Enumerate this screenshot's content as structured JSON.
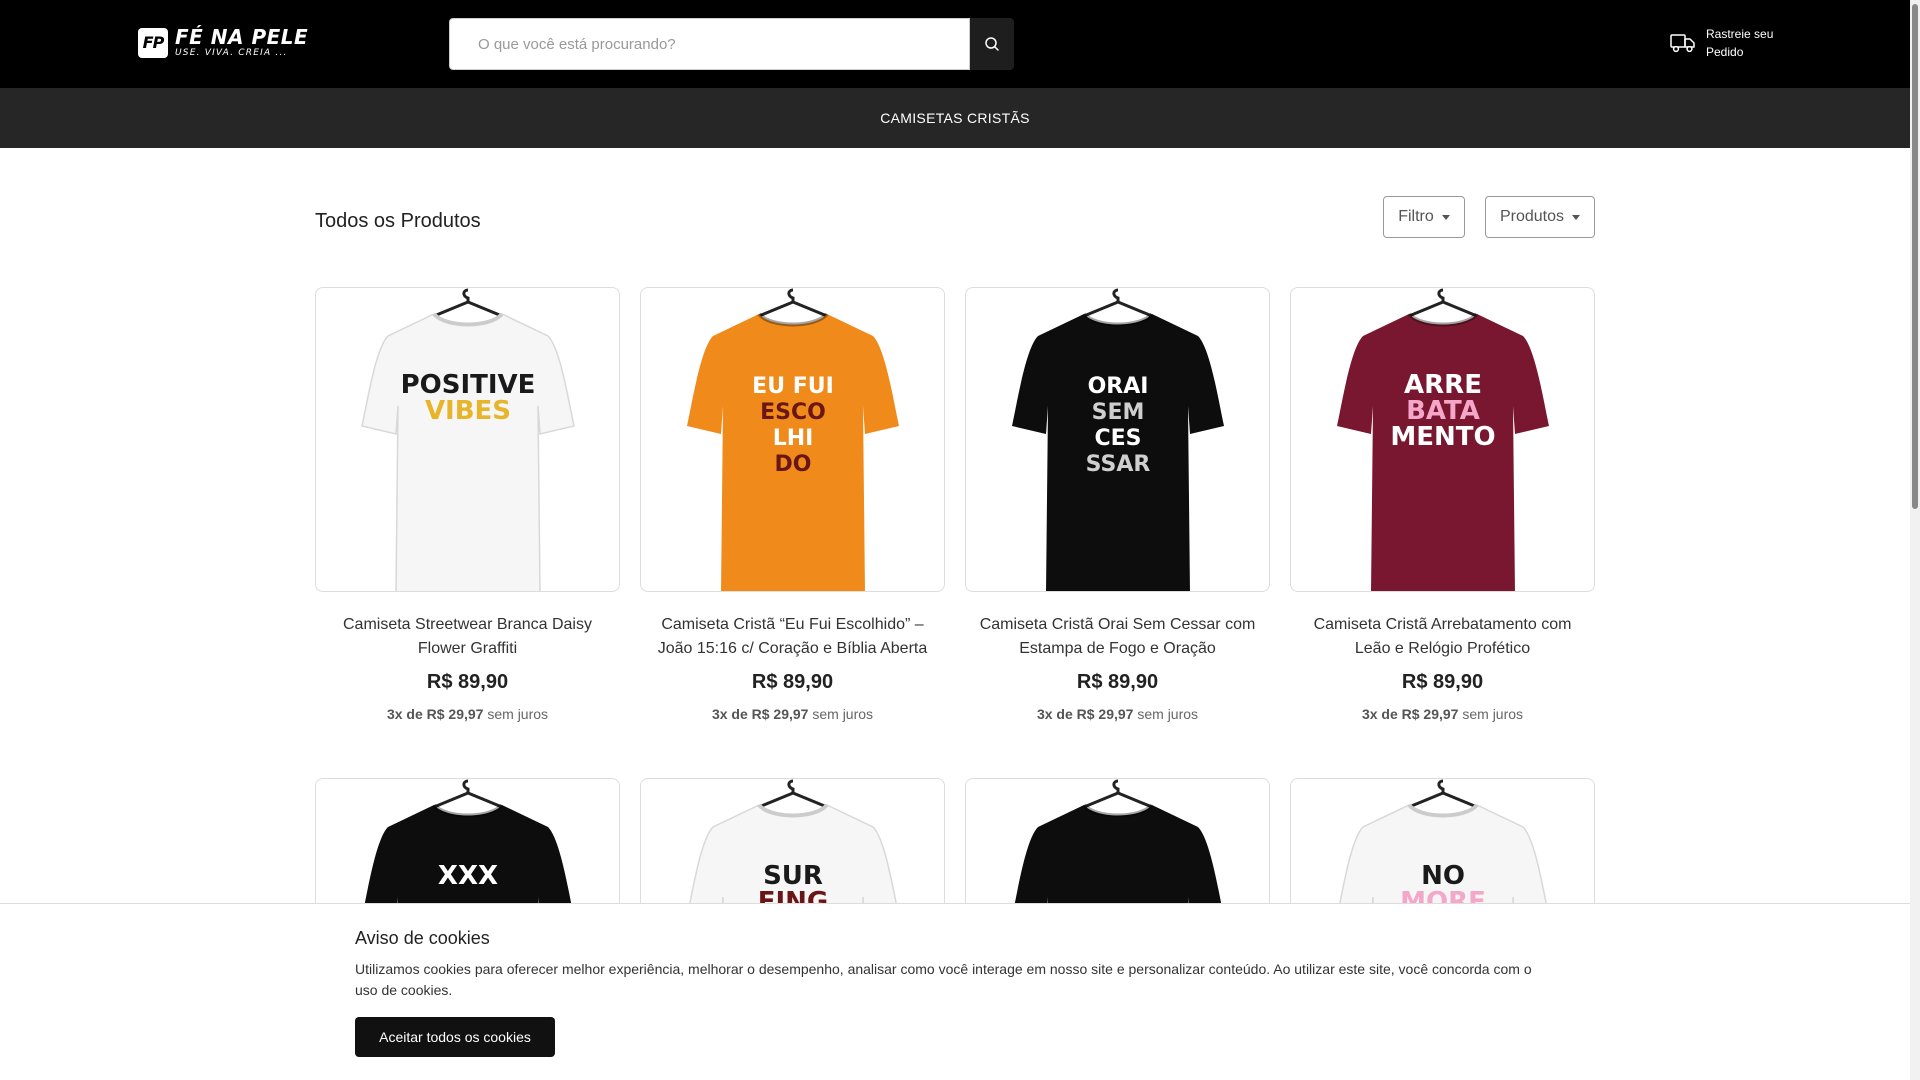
{
  "header": {
    "logo_mark": "FP",
    "logo_name": "FÉ NA PELE",
    "logo_tagline": "USE. VIVA. CREIA ...",
    "search_placeholder": "O que você está procurando?",
    "track_order": "Rastreie seu Pedido"
  },
  "nav": {
    "items": [
      {
        "label": "CAMISETAS CRISTÃS"
      }
    ]
  },
  "listing": {
    "title": "Todos os Produtos",
    "filter_label": "Filtro",
    "products_label": "Produtos"
  },
  "products": [
    {
      "name": "Camiseta Streetwear Branca Daisy Flower Graffiti",
      "price": "R$ 89,90",
      "installments": "3x de R$ 29,97",
      "installments_suffix": "sem juros",
      "shirt_color": "#f6f6f6",
      "print_text": [
        "POSITIVE",
        "VIBES"
      ]
    },
    {
      "name": "Camiseta Cristã “Eu Fui Escolhido” – João 15:16 c/ Coração e Bíblia Aberta",
      "price": "R$ 89,90",
      "installments": "3x de R$ 29,97",
      "installments_suffix": "sem juros",
      "shirt_color": "#f08b1b",
      "print_text": [
        "EU FUI",
        "ESCO",
        "LHI",
        "DO"
      ]
    },
    {
      "name": "Camiseta Cristã Orai Sem Cessar com Estampa de Fogo e Oração",
      "price": "R$ 89,90",
      "installments": "3x de R$ 29,97",
      "installments_suffix": "sem juros",
      "shirt_color": "#0d0d0d",
      "print_text": [
        "ORAI",
        "SEM",
        "CES",
        "SSAR"
      ]
    },
    {
      "name": "Camiseta Cristã Arrebatamento com Leão e Relógio Profético",
      "price": "R$ 89,90",
      "installments": "3x de R$ 29,97",
      "installments_suffix": "sem juros",
      "shirt_color": "#7a1730",
      "print_text": [
        "ARRE",
        "BATA",
        "MENTO"
      ]
    }
  ],
  "products_row2": [
    {
      "shirt_color": "#0d0d0d",
      "print_text": [
        "XXX"
      ]
    },
    {
      "shirt_color": "#f6f6f6",
      "print_text": [
        "SUR",
        "FING"
      ]
    },
    {
      "shirt_color": "#0d0d0d",
      "print_text": []
    },
    {
      "shirt_color": "#f6f6f6",
      "print_text": [
        "NO",
        "MORE"
      ]
    }
  ],
  "cookie": {
    "title": "Aviso de cookies",
    "text": "Utilizamos cookies para oferecer melhor experiência, melhorar o desempenho, analisar como você interage em nosso site e personalizar conteúdo. Ao utilizar este site, você concorda com o uso de cookies.",
    "accept_label": "Aceitar todos os cookies"
  },
  "icons": {
    "search": "search-icon",
    "truck": "truck-icon",
    "hanger": "hanger-icon"
  }
}
